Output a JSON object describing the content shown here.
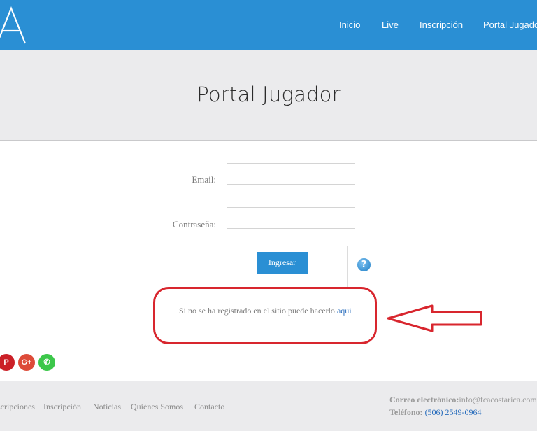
{
  "header": {
    "logo_letter": "A",
    "nav": [
      "Inicio",
      "Live",
      "Inscripción",
      "Portal Jugador"
    ]
  },
  "page": {
    "title": "Portal Jugador"
  },
  "form": {
    "email_label": "Email:",
    "email_value": "",
    "password_label": "Contraseña:",
    "password_value": "",
    "submit_label": "Ingresar",
    "help_symbol": "?",
    "register_text": "Si no se ha registrado en el sitio puede hacerlo ",
    "register_link": "aqui"
  },
  "social": [
    {
      "icon": "pinterest-icon",
      "glyph": "P",
      "color": "#cb2027"
    },
    {
      "icon": "google-plus-icon",
      "glyph": "G+",
      "color": "#dd4b39"
    },
    {
      "icon": "whatsapp-icon",
      "glyph": "✆",
      "color": "#3cc74a"
    }
  ],
  "footer": {
    "links": [
      "Inscripciones",
      "Inscripción",
      "Noticias",
      "Quiénes Somos",
      "Contacto"
    ],
    "email_label": "Correo electrónico:",
    "email_value": "info@fcacostarica.com",
    "phone_label": "Teléfono:",
    "phone_value": "(506) 2549-0964"
  },
  "colors": {
    "primary": "#2a8fd4",
    "annotation": "#d8262e",
    "band": "#ebebed"
  }
}
